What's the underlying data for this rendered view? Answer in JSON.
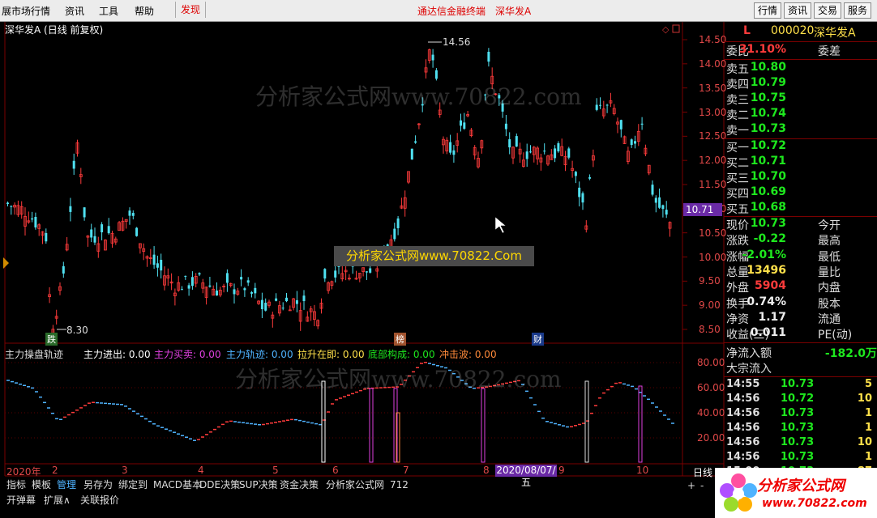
{
  "menubar": {
    "items": [
      "展市场行情",
      "资讯",
      "工具",
      "帮助",
      "发现"
    ],
    "center_links": [
      "通达信金融终端",
      "深华发A"
    ],
    "right_buttons": [
      "行情",
      "资讯",
      "交易",
      "服务"
    ]
  },
  "chart_title": "深华发A (日线 前复权)",
  "price_axis": [
    "14.50",
    "14.00",
    "13.50",
    "13.00",
    "12.50",
    "12.00",
    "11.50",
    "11.00",
    "10.50",
    "10.00",
    "9.50",
    "9.00",
    "8.50"
  ],
  "current_price_tag": "10.71",
  "high_label": "14.56",
  "low_label": "8.30",
  "markers": {
    "die": "跌",
    "bang": "榜",
    "cai": "财"
  },
  "watermark": "分析家公式网www.70822.com",
  "banner": "分析家公式网www.70822.Com",
  "indicator": {
    "name": "主力操盘轨迹",
    "items": [
      {
        "label": "主力进出: 0.00",
        "color": "#ffffff"
      },
      {
        "label": "主力买卖: 0.00",
        "color": "#e040e0"
      },
      {
        "label": "主力轨迹: 0.00",
        "color": "#4fb3ff"
      },
      {
        "label": "拉升在即: 0.00",
        "color": "#ffe14a"
      },
      {
        "label": "底部构成: 0.00",
        "color": "#1ee81e"
      },
      {
        "label": "冲击波: 0.00",
        "color": "#ff8a3a"
      }
    ],
    "axis": [
      "80.00",
      "60.00",
      "40.00",
      "20.00"
    ]
  },
  "x_axis": [
    "2020年",
    "2",
    "3",
    "4",
    "5",
    "6",
    "7",
    "8",
    "9",
    "10"
  ],
  "date_tag": "2020/08/07/五",
  "period_label": "日线",
  "stock": {
    "code": "000020",
    "name": "深华发A",
    "mark": "L"
  },
  "order_ratio": {
    "label": "委比",
    "value": "31.10%",
    "label2": "委差"
  },
  "asks": [
    {
      "label": "卖五",
      "price": "10.80"
    },
    {
      "label": "卖四",
      "price": "10.79"
    },
    {
      "label": "卖三",
      "price": "10.75"
    },
    {
      "label": "卖二",
      "price": "10.74"
    },
    {
      "label": "卖一",
      "price": "10.73"
    }
  ],
  "bids": [
    {
      "label": "买一",
      "price": "10.72"
    },
    {
      "label": "买二",
      "price": "10.71"
    },
    {
      "label": "买三",
      "price": "10.70"
    },
    {
      "label": "买四",
      "price": "10.69"
    },
    {
      "label": "买五",
      "price": "10.68"
    }
  ],
  "stats": [
    {
      "label": "现价",
      "value": "10.73",
      "color": "green",
      "label2": "今开"
    },
    {
      "label": "涨跌",
      "value": "-0.22",
      "color": "green",
      "label2": "最高"
    },
    {
      "label": "涨幅",
      "value": "-2.01%",
      "color": "green",
      "label2": "最低"
    },
    {
      "label": "总量",
      "value": "13496",
      "color": "yellow",
      "label2": "量比"
    },
    {
      "label": "外盘",
      "value": "5904",
      "color": "red",
      "label2": "内盘"
    },
    {
      "label": "换手",
      "value": "0.74%",
      "color": "white",
      "label2": "股本"
    },
    {
      "label": "净资",
      "value": "1.17",
      "color": "white",
      "label2": "流通"
    },
    {
      "label": "收益(三)",
      "value": "0.011",
      "color": "white",
      "label2": "PE(动)"
    }
  ],
  "net_inflow": {
    "label": "净流入额",
    "value": "-182.0万"
  },
  "block_inflow": {
    "label": "大宗流入"
  },
  "ticks": [
    {
      "time": "14:55",
      "price": "10.73",
      "vol": "5"
    },
    {
      "time": "14:56",
      "price": "10.72",
      "vol": "10"
    },
    {
      "time": "14:56",
      "price": "10.73",
      "vol": "1"
    },
    {
      "time": "14:56",
      "price": "10.73",
      "vol": "1"
    },
    {
      "time": "14:56",
      "price": "10.73",
      "vol": "10"
    },
    {
      "time": "14:56",
      "price": "10.73",
      "vol": "1"
    },
    {
      "time": "15:00",
      "price": "10.73",
      "vol": "87"
    }
  ],
  "bottom_tabs": [
    "指标",
    "模板",
    "管理",
    "另存为",
    "绑定到",
    "MACD基本",
    "DDE决策",
    "SUP决策",
    "资金决策",
    "分析家公式网",
    "712"
  ],
  "bottom_tabs_active": "管理",
  "bottom_bar": [
    "开弹幕",
    "扩展∧",
    "关联报价"
  ],
  "logo": {
    "text": "分析家公式网",
    "url": "www.70822.com"
  },
  "colors": {
    "up": "#ff3b3b",
    "down": "#4fe0f0",
    "divider": "#7a0000",
    "purple_tag": "#6a2aa6"
  }
}
